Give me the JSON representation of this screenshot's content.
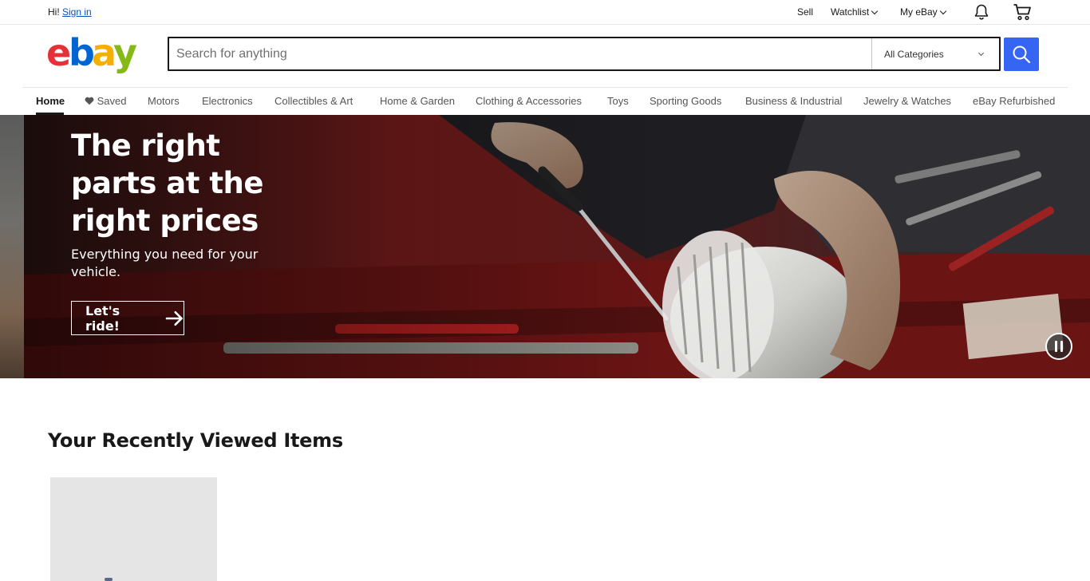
{
  "topbar": {
    "greeting": "Hi!",
    "sign_in": "Sign in",
    "sell": "Sell",
    "watchlist": "Watchlist",
    "my_ebay": "My eBay"
  },
  "header": {
    "logo_letters": [
      "e",
      "b",
      "a",
      "y"
    ],
    "logo_colors": [
      "#e53238",
      "#0064d2",
      "#f5af02",
      "#86b817"
    ],
    "search_placeholder": "Search for anything",
    "category_selected": "All Categories",
    "accent_color": "#3665f3"
  },
  "nav": {
    "items": [
      {
        "label": "Home",
        "active": true
      },
      {
        "label": "Saved",
        "icon": "heart-icon"
      },
      {
        "label": "Motors"
      },
      {
        "label": "Electronics"
      },
      {
        "label": "Collectibles & Art"
      },
      {
        "label": "Home & Garden"
      },
      {
        "label": "Clothing & Accessories"
      },
      {
        "label": "Toys"
      },
      {
        "label": "Sporting Goods"
      },
      {
        "label": "Business & Industrial"
      },
      {
        "label": "Jewelry & Watches"
      },
      {
        "label": "eBay Refurbished"
      }
    ]
  },
  "hero": {
    "title": "The right parts at the right prices",
    "subtitle": "Everything you need for your vehicle.",
    "cta": "Let's ride!"
  },
  "recently_viewed": {
    "title": "Your Recently Viewed Items"
  }
}
